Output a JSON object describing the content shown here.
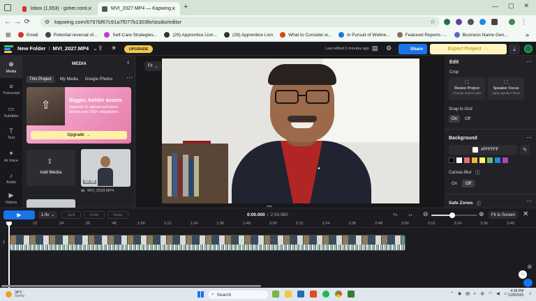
{
  "browser": {
    "tabs": [
      {
        "title": "Inbox (1,653) - goher.contact@...",
        "active": false,
        "color": "#d93025"
      },
      {
        "title": "MVI_2027.MP4 — Kapwing",
        "active": true,
        "color": "#555555"
      }
    ],
    "new_tab": "+",
    "url": "kapwing.com/6797bf67c91a7f077b1303fe/studio/editor",
    "bookmarks": [
      {
        "label": "Gmail",
        "color": "#d93025"
      },
      {
        "label": "Potential reversal of...",
        "color": "#444444"
      },
      {
        "label": "Self-Care Strategies...",
        "color": "#c23bd4"
      },
      {
        "label": "(29) Apprentice Lion...",
        "color": "#333333"
      },
      {
        "label": "(29) Apprentice Lion",
        "color": "#333333"
      },
      {
        "label": "What to Consider w...",
        "color": "#d9480f"
      },
      {
        "label": "In Pursuit of Wellne...",
        "color": "#1a73e8"
      },
      {
        "label": "Featured Reports -...",
        "color": "#8d6e63"
      },
      {
        "label": "Business Name Gen...",
        "color": "#5c6bc0"
      }
    ],
    "all_bookmarks": "All Bookmarks"
  },
  "app": {
    "folder": "New Folder",
    "file_name": "MVI_2027.MP4",
    "upgrade": "UPGRADE",
    "last_edited": "Last edited 2 minutes ago",
    "share": "Share",
    "export": "Export Project",
    "colors": {
      "accent": "#1a73e8",
      "upgrade": "#f2c94c",
      "export_bg": "#fff5c2"
    }
  },
  "leftrail": [
    {
      "label": "Media",
      "icon": "media-icon",
      "glyph": "⊕",
      "active": true
    },
    {
      "label": "Transcript",
      "icon": "transcript-icon",
      "glyph": "≡",
      "active": false
    },
    {
      "label": "Subtitles",
      "icon": "subtitles-icon",
      "glyph": "▭",
      "active": false
    },
    {
      "label": "Text",
      "icon": "text-icon",
      "glyph": "T",
      "active": false
    },
    {
      "label": "AI Voice",
      "icon": "ai-voice-icon",
      "glyph": "✦",
      "active": false
    },
    {
      "label": "Audio",
      "icon": "audio-icon",
      "glyph": "♪",
      "active": false
    },
    {
      "label": "Videos",
      "icon": "videos-icon",
      "glyph": "▶",
      "active": false
    }
  ],
  "media": {
    "title": "MEDIA",
    "tabs": [
      "This Project",
      "My Media",
      "Google Photos"
    ],
    "promo_title": "Bigger, bolder assets",
    "promo_text": "Upgrade to upload and store assets over 250+ megabytes",
    "promo_button": "Upgrade",
    "add_media": "Add Media",
    "clip_duration": "02:59",
    "clip_name": "MVI_2028.MP4"
  },
  "canvas": {
    "fit": "Fit"
  },
  "edit": {
    "title": "Edit",
    "crop_label": "Crop",
    "resize_title": "Resize Project",
    "resize_sub": "Change aspect ratio",
    "speaker_title": "Speaker Focus",
    "speaker_sub": "Apply speaker focus",
    "snap_label": "Snap to Grid",
    "on": "On",
    "off": "Off",
    "background_title": "Background",
    "bg_color": "#FFFFFF",
    "swatches": [
      "#000000",
      "#ffffff",
      "#e57373",
      "#f2b53a",
      "#fff176",
      "#66bb6a",
      "#1e88e5",
      "#ab47bc"
    ],
    "canvas_blur": "Canvas Blur",
    "safe_zones": "Safe Zones"
  },
  "timeline": {
    "speed": "1.0x",
    "split": "Split",
    "undo": "Undo",
    "redo": "Redo",
    "current_time": "0:00.000",
    "total_time": "2:59.960",
    "fit_to_screen": "Fit to Screen",
    "zoom_level": 0.45,
    "track_number": "1",
    "ticks": [
      ":00",
      ":12",
      ":24",
      ":36",
      ":48",
      "1:00",
      "1:12",
      "1:24",
      "1:36",
      "1:48",
      "2:00",
      "2:12",
      "2:24",
      "2:36",
      "2:48",
      "3:00",
      "3:12",
      "3:24",
      "3:36",
      "3:48"
    ]
  },
  "taskbar": {
    "weather_temp": "38°C",
    "weather_desc": "Sunny",
    "search": "Search",
    "time": "4:28 PM",
    "date": "1/28/2025"
  }
}
